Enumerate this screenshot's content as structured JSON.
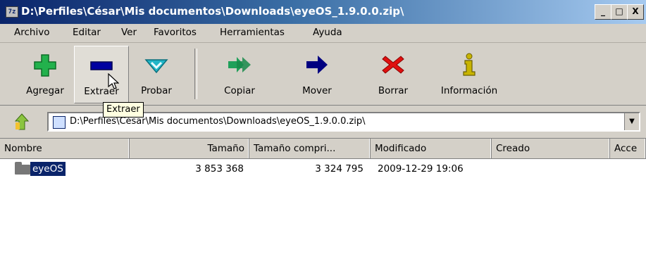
{
  "window": {
    "title": "D:\\Perfiles\\César\\Mis documentos\\Downloads\\eyeOS_1.9.0.0.zip\\",
    "icon": "7z",
    "controls": {
      "minimize": "_",
      "maximize": "□",
      "close": "X"
    }
  },
  "menu": [
    "Archivo",
    "Editar",
    "Ver",
    "Favoritos",
    "Herramientas",
    "Ayuda"
  ],
  "toolbar": {
    "buttons": [
      {
        "label": "Agregar",
        "icon": "plus-icon",
        "color": "#22b14c"
      },
      {
        "label": "Extraer",
        "icon": "minus-icon",
        "color": "#0000a0"
      },
      {
        "label": "Probar",
        "icon": "check-icon",
        "color": "#21b6c8"
      },
      {
        "label": "Copiar",
        "icon": "double-arrow-icon",
        "color": "#1fa05a"
      },
      {
        "label": "Mover",
        "icon": "arrow-right-icon",
        "color": "#000080"
      },
      {
        "label": "Borrar",
        "icon": "x-icon",
        "color": "#e01010"
      },
      {
        "label": "Información",
        "icon": "info-icon",
        "color": "#c8b400"
      }
    ],
    "tooltip": "Extraer"
  },
  "address": {
    "path": "D:\\Perfiles\\César\\Mis documentos\\Downloads\\eyeOS_1.9.0.0.zip\\"
  },
  "list": {
    "columns": [
      "Nombre",
      "Tamaño",
      "Tamaño compri...",
      "Modificado",
      "Creado",
      "Acce"
    ],
    "rows": [
      {
        "name": "eyeOS",
        "size": "3 853 368",
        "packed": "3 324 795",
        "modified": "2009-12-29 19:06",
        "created": "",
        "accessed": ""
      }
    ]
  },
  "colors": {
    "selection": "#0a246a",
    "chrome": "#d4d0c8",
    "titlebar": "#0a246a"
  }
}
